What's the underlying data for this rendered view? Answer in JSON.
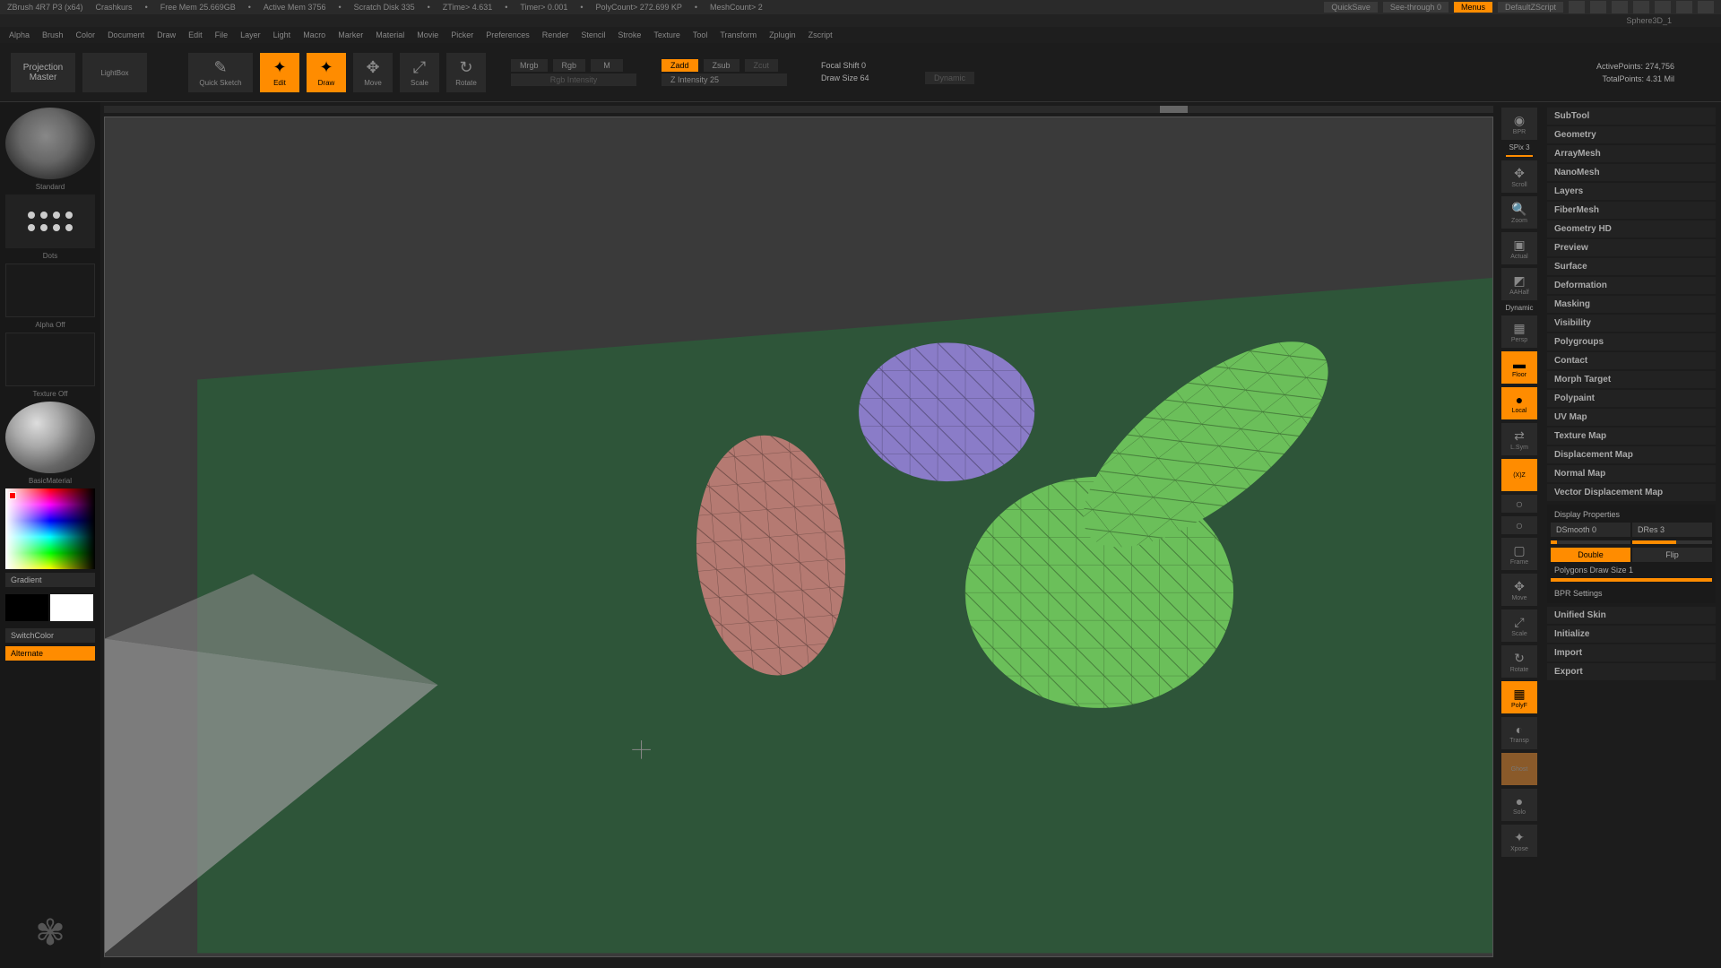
{
  "titlebar": {
    "app": "ZBrush 4R7 P3 (x64)",
    "project": "Crashkurs",
    "stats": [
      "Free Mem 25.669GB",
      "Active Mem 3756",
      "Scratch Disk 335",
      "ZTime> 4.631",
      "Timer> 0.001",
      "PolyCount> 272.699 KP",
      "MeshCount> 2"
    ],
    "quicksave": "QuickSave",
    "seethrough": "See-through  0",
    "menus": "Menus",
    "script": "DefaultZScript",
    "subname": "Sphere3D_1"
  },
  "menubar": [
    "Alpha",
    "Brush",
    "Color",
    "Document",
    "Draw",
    "Edit",
    "File",
    "Layer",
    "Light",
    "Macro",
    "Marker",
    "Material",
    "Movie",
    "Picker",
    "Preferences",
    "Render",
    "Stencil",
    "Stroke",
    "Texture",
    "Tool",
    "Transform",
    "Zplugin",
    "Zscript"
  ],
  "toolbar": {
    "projmaster1": "Projection",
    "projmaster2": "Master",
    "lightbox": "LightBox",
    "quicksketch": "Quick Sketch",
    "edit": "Edit",
    "draw": "Draw",
    "move": "Move",
    "scale": "Scale",
    "rotate": "Rotate",
    "mrgb": "Mrgb",
    "rgb": "Rgb",
    "m": "M",
    "rgbintensity": "Rgb Intensity",
    "zadd": "Zadd",
    "zsub": "Zsub",
    "zcut": "Zcut",
    "zintensity": "Z Intensity 25",
    "focalshift": "Focal Shift 0",
    "drawsize": "Draw Size 64",
    "dynamic": "Dynamic",
    "activepoints": "ActivePoints:  274,756",
    "totalpoints": "TotalPoints: 4.31 Mil"
  },
  "left": {
    "brush": "Standard",
    "stroke": "Dots",
    "alpha": "Alpha  Off",
    "texture": "Texture  Off",
    "material": "BasicMaterial",
    "gradient": "Gradient",
    "switchcolor": "SwitchColor",
    "alternate": "Alternate"
  },
  "rightstrip": {
    "spix": "SPix 3",
    "items": [
      "BPR",
      "Scroll",
      "Zoom",
      "Actual",
      "AAHalf",
      "Persp",
      "Floor",
      "Local",
      "L.Sym",
      "(X)Z",
      "Frame",
      "Move",
      "Scale",
      "Rotate",
      "PolyF",
      "Transp",
      "Ghost",
      "Solo",
      "Xpose"
    ],
    "dynamic": "Dynamic"
  },
  "rightpanel": {
    "items": [
      "SubTool",
      "Geometry",
      "ArrayMesh",
      "NanoMesh",
      "Layers",
      "FiberMesh",
      "Geometry HD",
      "Preview",
      "Surface",
      "Deformation",
      "Masking",
      "Visibility",
      "Polygroups",
      "Contact",
      "Morph Target",
      "Polypaint",
      "UV Map",
      "Texture Map",
      "Displacement Map",
      "Normal Map",
      "Vector Displacement Map"
    ],
    "display_props": "Display Properties",
    "dsmooth": "DSmooth 0",
    "dres": "DRes 3",
    "double": "Double",
    "flip": "Flip",
    "polydrawsize": "Polygons Draw Size 1",
    "bpr": "BPR Settings",
    "tail": [
      "Unified Skin",
      "Initialize",
      "Import",
      "Export"
    ]
  }
}
